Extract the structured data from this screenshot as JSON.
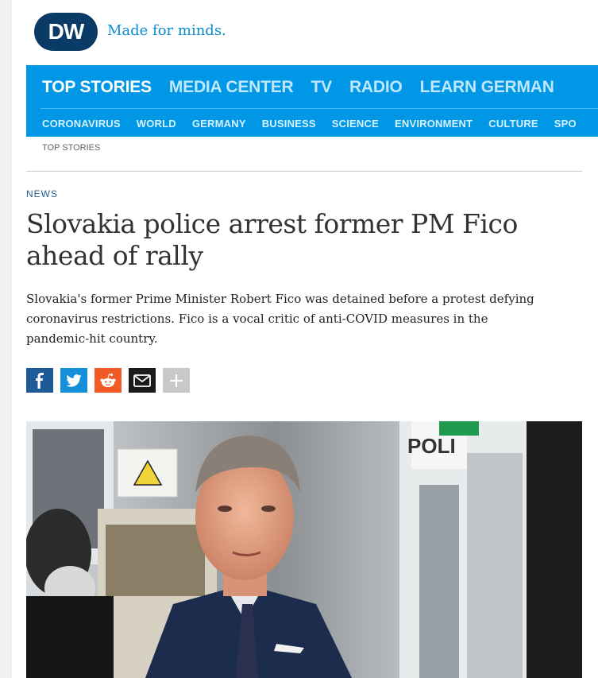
{
  "brand": {
    "logo_text": "DW",
    "tagline": "Made for minds.",
    "logo_color": "#0a3a66",
    "tagline_color": "#0b8dcf"
  },
  "nav": {
    "bg_color": "#0098e6",
    "main": [
      {
        "label": "TOP STORIES",
        "active": true
      },
      {
        "label": "MEDIA CENTER",
        "active": false
      },
      {
        "label": "TV",
        "active": false
      },
      {
        "label": "RADIO",
        "active": false
      },
      {
        "label": "LEARN GERMAN",
        "active": false
      }
    ],
    "sub": [
      {
        "label": "CORONAVIRUS"
      },
      {
        "label": "WORLD"
      },
      {
        "label": "GERMANY"
      },
      {
        "label": "BUSINESS"
      },
      {
        "label": "SCIENCE"
      },
      {
        "label": "ENVIRONMENT"
      },
      {
        "label": "CULTURE"
      },
      {
        "label": "SPO"
      }
    ]
  },
  "breadcrumb": "TOP STORIES",
  "article": {
    "kicker": "NEWS",
    "headline": "Slovakia police arrest former PM Fico ahead of rally",
    "teaser": "Slovakia's former Prime Minister Robert Fico was detained before a protest defying coronavirus restrictions. Fico is a vocal critic of anti-COVID measures in the pandemic-hit country."
  },
  "share": [
    {
      "icon": "facebook-icon",
      "color": "#1f5a98"
    },
    {
      "icon": "twitter-icon",
      "color": "#1590d8"
    },
    {
      "icon": "reddit-icon",
      "color": "#f15a24"
    },
    {
      "icon": "email-icon",
      "color": "#1b1b1b"
    },
    {
      "icon": "more-icon",
      "color": "#c8c8c8"
    }
  ],
  "photo": {
    "sign_text": "POLI"
  }
}
